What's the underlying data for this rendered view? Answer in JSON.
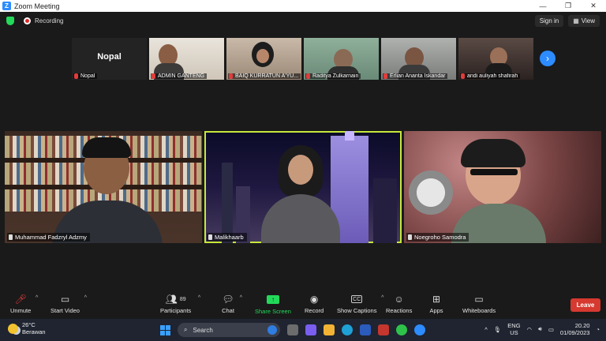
{
  "window": {
    "title": "Zoom Meeting"
  },
  "topbar": {
    "recording_label": "Recording",
    "signin_label": "Sign in",
    "view_label": "View"
  },
  "thumbnails": [
    {
      "name": "Nopal",
      "center_label": "Nopal"
    },
    {
      "name": "ADMIN GANTENG"
    },
    {
      "name": "BAIQ KURRATUN A'YU..."
    },
    {
      "name": "Raditya Zulkarnain"
    },
    {
      "name": "Erlian Ananta Iskandar"
    },
    {
      "name": "andi auliyah shafirah"
    }
  ],
  "speakers": [
    {
      "name": "Muhammad Fadzryl Adzmy"
    },
    {
      "name": "Malikhaarb"
    },
    {
      "name": "Noegroho Samodra"
    }
  ],
  "toolbar": {
    "unmute": "Unmute",
    "start_video": "Start Video",
    "participants": "Participants",
    "participants_count": "89",
    "chat": "Chat",
    "share_screen": "Share Screen",
    "record": "Record",
    "show_captions": "Show Captions",
    "captions_icon_text": "CC",
    "reactions": "Reactions",
    "apps": "Apps",
    "whiteboards": "Whiteboards",
    "leave": "Leave"
  },
  "taskbar": {
    "temperature": "26°C",
    "weather": "Berawan",
    "search_placeholder": "Search",
    "lang_top": "ENG",
    "lang_bottom": "US",
    "time": "20.20",
    "date": "01/09/2023"
  },
  "colors": {
    "accent": "#2d8cff",
    "active_speaker": "#c6e83c",
    "leave": "#d6392f",
    "share": "#23d959"
  }
}
